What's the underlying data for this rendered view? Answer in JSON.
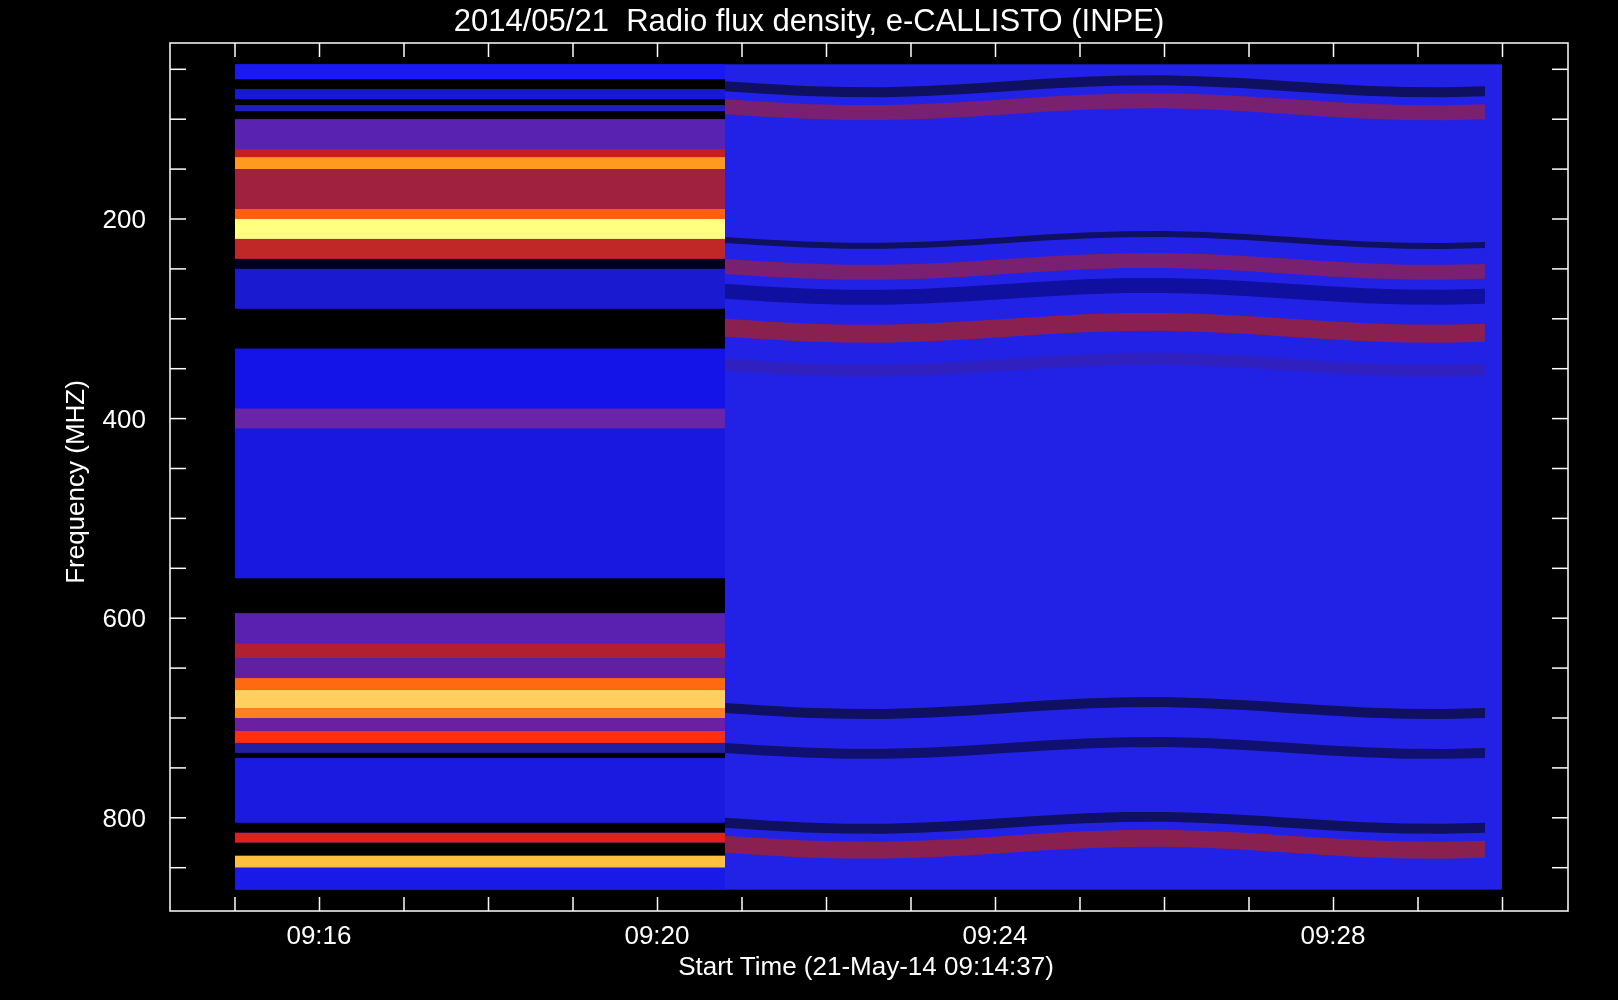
{
  "chart": {
    "title": "2014/05/21  Radio flux density, e-CALLISTO (INPE)",
    "xlabel": "Start Time (21-May-14 09:14:37)",
    "ylabel": "Frequency (MHZ)",
    "xticks": [
      "09:16",
      "09:20",
      "09:24",
      "09:28"
    ],
    "yticks": [
      "200",
      "400",
      "600",
      "800"
    ]
  }
}
